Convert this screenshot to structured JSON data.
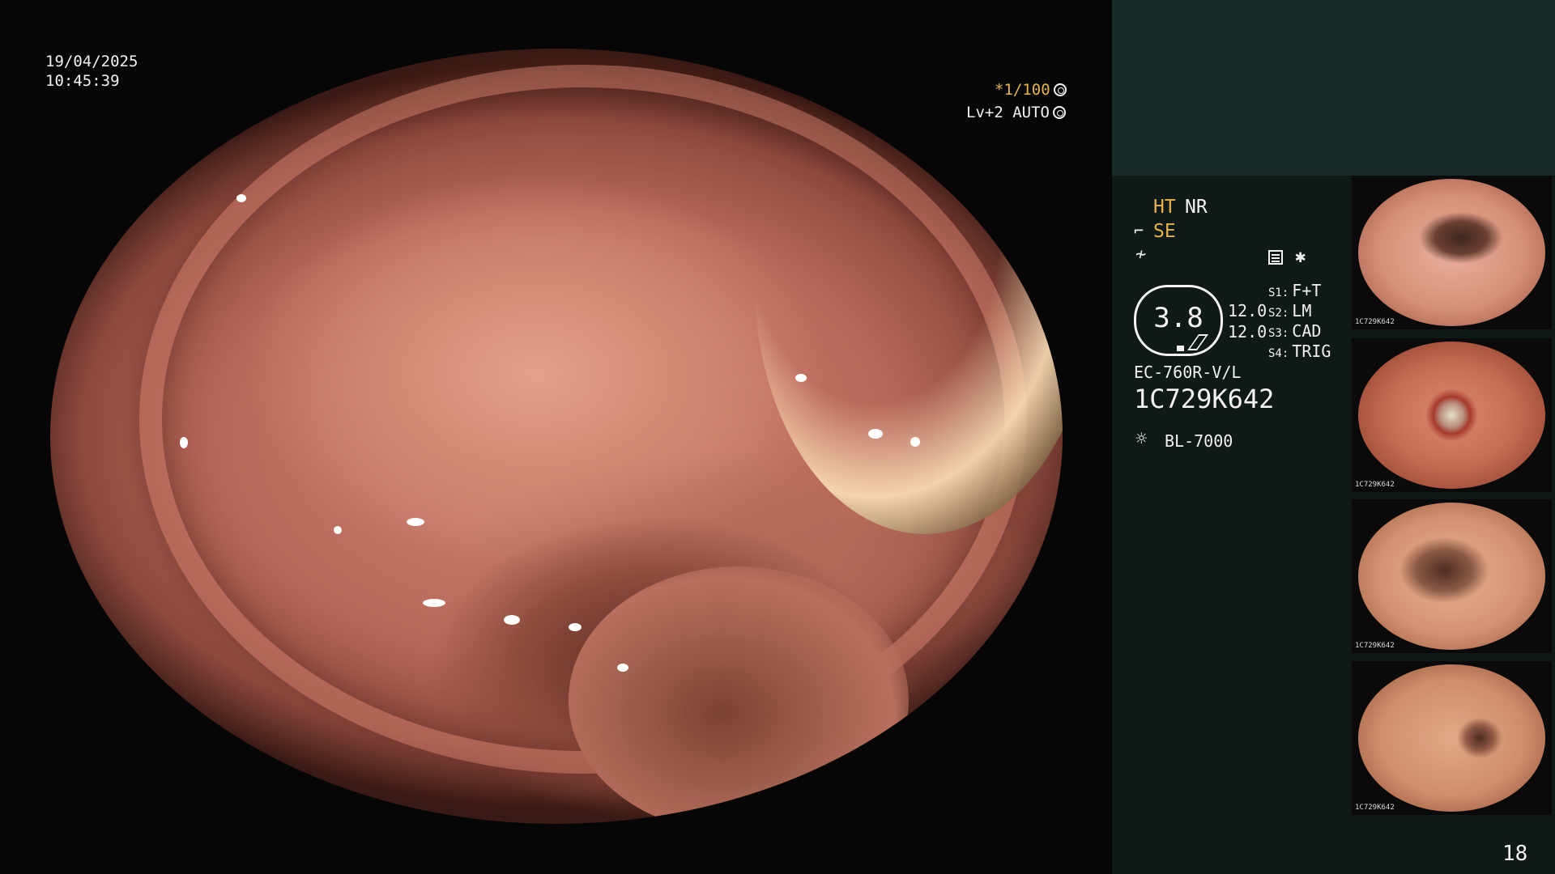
{
  "overlay": {
    "date": "19/04/2025",
    "time": "10:45:39",
    "shutter": "*1/100",
    "level": "Lv+2 AUTO"
  },
  "panel": {
    "ht": "HT",
    "nr": "NR",
    "se": "SE",
    "lens_value": "3.8",
    "value_1": "12.0",
    "value_2": "12.0",
    "soft_keys": [
      {
        "key": "S1:",
        "label": "F+T"
      },
      {
        "key": "S2:",
        "label": "LM"
      },
      {
        "key": "S3:",
        "label": "CAD"
      },
      {
        "key": "S4:",
        "label": "TRIG"
      }
    ],
    "scope_model": "EC-760R-V/L",
    "serial": "1C729K642",
    "light_source": "BL-7000"
  },
  "thumbnails": [
    {
      "caption": "1C729K642"
    },
    {
      "caption": "1C729K642"
    },
    {
      "caption": "1C729K642"
    },
    {
      "caption": "1C729K642"
    }
  ],
  "page_number": "18",
  "icons": {
    "shutter": "aperture-icon",
    "level": "auto-iris-icon",
    "se": "scissors-icon",
    "f": "function-icon",
    "menu": "settings-list-icon",
    "star": "asterisk-icon",
    "light": "sun-icon"
  },
  "colors": {
    "accent_yellow": "#e5b34a",
    "panel_top": "#172b28",
    "panel": "#0f1918"
  }
}
